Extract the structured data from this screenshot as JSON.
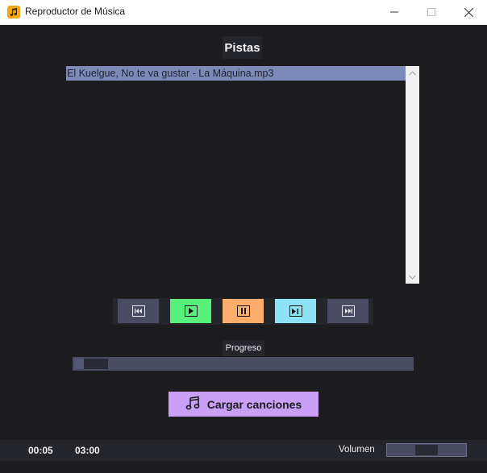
{
  "window": {
    "title": "Reproductor de Música",
    "controls": [
      "minimize",
      "maximize",
      "close"
    ]
  },
  "tracks": {
    "heading": "Pistas",
    "items": [
      "El Kuelgue, No te va gustar - La Máquina.mp3"
    ],
    "selected_index": 0
  },
  "controls": [
    {
      "name": "previous",
      "color": "#4a4c63",
      "icon": "skip-back-icon"
    },
    {
      "name": "play",
      "color": "#58f07a",
      "icon": "play-icon"
    },
    {
      "name": "pause",
      "color": "#ffad6b",
      "icon": "pause-icon"
    },
    {
      "name": "stop-next",
      "color": "#8be3f5",
      "icon": "stop-next-icon"
    },
    {
      "name": "next",
      "color": "#4a4c63",
      "icon": "skip-forward-icon"
    }
  ],
  "progress": {
    "label": "Progreso",
    "value_fraction": 0.03
  },
  "load_button": {
    "label": "Cargar canciones",
    "icon": "music-note-icon",
    "color": "#c9a0f5"
  },
  "footer": {
    "current_time": "00:05",
    "total_time": "03:00",
    "volume_label": "Volumen",
    "volume_fraction": 0.5
  }
}
